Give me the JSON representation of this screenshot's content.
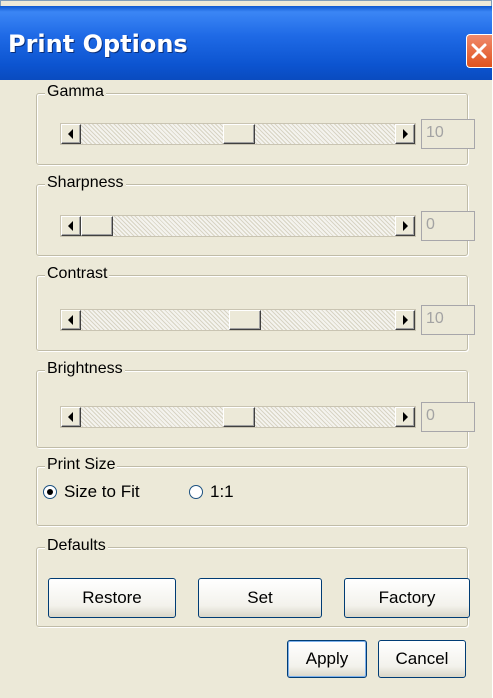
{
  "window": {
    "title": "Print Options"
  },
  "sliders": [
    {
      "label": "Gamma",
      "value": "10",
      "thumb_fraction": 0.5
    },
    {
      "label": "Sharpness",
      "value": "0",
      "thumb_fraction": 0.03
    },
    {
      "label": "Contrast",
      "value": "10",
      "thumb_fraction": 0.52
    },
    {
      "label": "Brightness",
      "value": "0",
      "thumb_fraction": 0.5
    }
  ],
  "print_size": {
    "label": "Print Size",
    "options": [
      {
        "label": "Size to Fit",
        "selected": true
      },
      {
        "label": "1:1",
        "selected": false
      }
    ]
  },
  "defaults": {
    "label": "Defaults",
    "buttons": [
      "Restore",
      "Set",
      "Factory"
    ]
  },
  "footer": {
    "apply_label": "Apply",
    "cancel_label": "Cancel"
  },
  "colors": {
    "titlebar": "#0c54d0",
    "close": "#e0531e",
    "face": "#ece9d8",
    "disabled_text": "#a3a3a3"
  }
}
